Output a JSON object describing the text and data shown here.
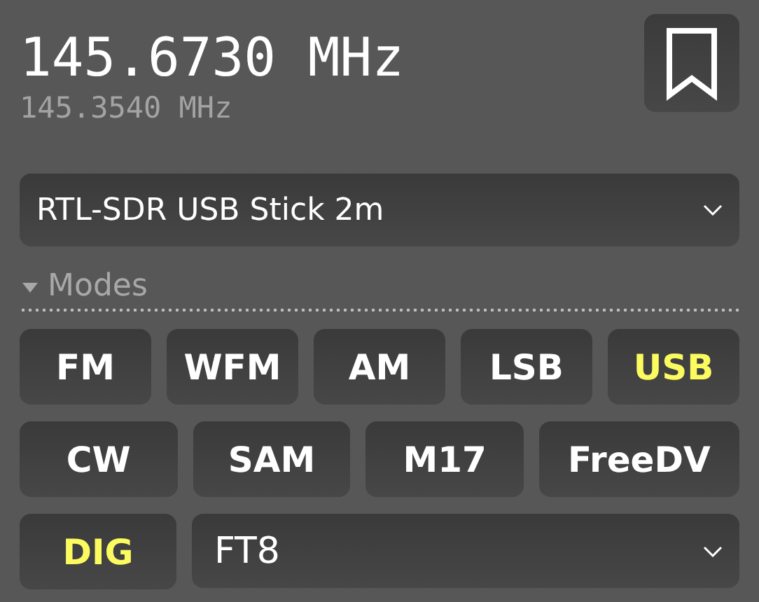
{
  "frequency": "145.6730 MHz",
  "offset_frequency": "145.3540 MHz",
  "device_select": {
    "value": "RTL-SDR USB Stick 2m"
  },
  "modes_section": {
    "label": "Modes",
    "expanded": true
  },
  "mode_rows": [
    [
      {
        "label": "FM",
        "selected": false
      },
      {
        "label": "WFM",
        "selected": false
      },
      {
        "label": "AM",
        "selected": false
      },
      {
        "label": "LSB",
        "selected": false
      },
      {
        "label": "USB",
        "selected": true
      }
    ],
    [
      {
        "label": "CW",
        "selected": false
      },
      {
        "label": "SAM",
        "selected": false
      },
      {
        "label": "M17",
        "selected": false
      },
      {
        "label": "FreeDV",
        "selected": false
      }
    ],
    [
      {
        "label": "DIG",
        "selected": true
      }
    ]
  ],
  "digital_mode_select": {
    "value": "FT8"
  }
}
